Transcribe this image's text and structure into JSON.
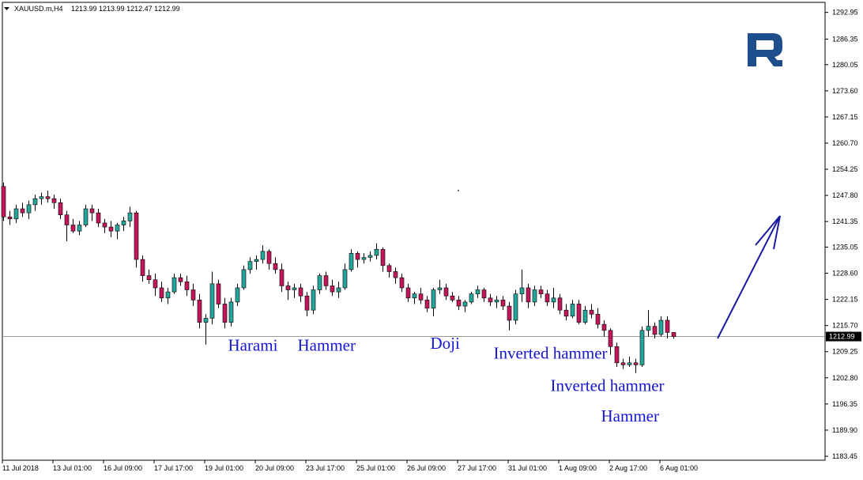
{
  "header": {
    "symbol": "XAUUSD.m,H4",
    "ohlc": "1213.99 1213.99 1212.47 1212.99"
  },
  "colors": {
    "bull": "#26a69a",
    "bear": "#c2185b",
    "annotation": "#1515d6",
    "arrow": "#1a1aa0",
    "logo": "#1f4e8c"
  },
  "chart_data": {
    "type": "candlestick",
    "ylim": [
      1183.45,
      1296.0
    ],
    "grid": false,
    "current_price": 1212.99,
    "current_price_label": "1212.99",
    "y_ticks": [
      "1292.95",
      "1286.35",
      "1280.05",
      "1273.60",
      "1267.15",
      "1260.70",
      "1254.25",
      "1247.80",
      "1241.35",
      "1235.05",
      "1228.60",
      "1222.15",
      "1215.70",
      "1209.25",
      "1202.80",
      "1196.35",
      "1189.90",
      "1183.45"
    ],
    "x_ticks": [
      "11 Jul 2018",
      "13 Jul 01:00",
      "16 Jul 09:00",
      "17 Jul 17:00",
      "19 Jul 01:00",
      "20 Jul 09:00",
      "23 Jul 17:00",
      "25 Jul 01:00",
      "26 Jul 09:00",
      "27 Jul 17:00",
      "31 Jul 01:00",
      "1 Aug 09:00",
      "2 Aug 17:00",
      "6 Aug 01:00"
    ],
    "candles": [
      [
        1250.0,
        1251.0,
        1241.5,
        1242.5
      ],
      [
        1242.5,
        1244.0,
        1240.5,
        1242.0
      ],
      [
        1242.0,
        1245.5,
        1241.0,
        1244.5
      ],
      [
        1244.5,
        1246.0,
        1242.5,
        1243.5
      ],
      [
        1243.5,
        1246.5,
        1242.0,
        1245.5
      ],
      [
        1245.5,
        1248.0,
        1244.0,
        1247.0
      ],
      [
        1247.0,
        1248.5,
        1245.5,
        1247.5
      ],
      [
        1247.5,
        1249.0,
        1246.0,
        1247.0
      ],
      [
        1247.0,
        1248.0,
        1244.5,
        1246.0
      ],
      [
        1246.0,
        1247.0,
        1242.0,
        1243.0
      ],
      [
        1243.0,
        1244.0,
        1236.5,
        1240.5
      ],
      [
        1240.5,
        1242.0,
        1238.5,
        1239.0
      ],
      [
        1239.0,
        1241.5,
        1238.0,
        1240.5
      ],
      [
        1240.5,
        1245.5,
        1240.0,
        1244.5
      ],
      [
        1244.5,
        1245.5,
        1241.5,
        1243.5
      ],
      [
        1243.5,
        1244.5,
        1240.0,
        1241.0
      ],
      [
        1241.0,
        1242.0,
        1238.5,
        1240.0
      ],
      [
        1240.0,
        1241.5,
        1237.5,
        1239.0
      ],
      [
        1239.0,
        1241.0,
        1237.0,
        1240.5
      ],
      [
        1240.5,
        1242.5,
        1239.0,
        1241.5
      ],
      [
        1241.5,
        1245.0,
        1240.0,
        1243.5
      ],
      [
        1243.5,
        1244.0,
        1230.0,
        1232.0
      ],
      [
        1232.0,
        1233.0,
        1226.5,
        1228.0
      ],
      [
        1228.0,
        1229.5,
        1226.0,
        1227.0
      ],
      [
        1227.0,
        1228.5,
        1223.0,
        1225.0
      ],
      [
        1225.0,
        1226.5,
        1221.5,
        1222.5
      ],
      [
        1222.5,
        1225.0,
        1221.0,
        1224.0
      ],
      [
        1224.0,
        1228.5,
        1223.5,
        1227.5
      ],
      [
        1227.5,
        1228.5,
        1225.5,
        1226.5
      ],
      [
        1226.5,
        1228.0,
        1223.0,
        1224.5
      ],
      [
        1224.5,
        1226.0,
        1220.5,
        1222.0
      ],
      [
        1222.0,
        1223.5,
        1215.0,
        1216.5
      ],
      [
        1216.5,
        1218.5,
        1211.0,
        1217.5
      ],
      [
        1217.5,
        1229.0,
        1216.0,
        1226.0
      ],
      [
        1226.0,
        1227.0,
        1220.0,
        1221.0
      ],
      [
        1221.0,
        1222.5,
        1215.0,
        1216.5
      ],
      [
        1216.5,
        1222.5,
        1215.5,
        1221.5
      ],
      [
        1221.5,
        1226.0,
        1220.5,
        1225.0
      ],
      [
        1225.0,
        1230.5,
        1224.5,
        1229.5
      ],
      [
        1229.5,
        1232.5,
        1228.5,
        1231.5
      ],
      [
        1231.5,
        1233.0,
        1229.5,
        1232.0
      ],
      [
        1232.0,
        1235.5,
        1231.0,
        1234.0
      ],
      [
        1234.0,
        1234.5,
        1229.5,
        1231.0
      ],
      [
        1231.0,
        1232.5,
        1228.5,
        1229.5
      ],
      [
        1229.5,
        1231.0,
        1224.0,
        1225.5
      ],
      [
        1225.5,
        1226.5,
        1222.0,
        1224.5
      ],
      [
        1224.5,
        1226.0,
        1222.5,
        1225.0
      ],
      [
        1225.0,
        1226.0,
        1221.5,
        1223.0
      ],
      [
        1223.0,
        1224.0,
        1218.0,
        1219.5
      ],
      [
        1219.5,
        1225.5,
        1218.5,
        1224.5
      ],
      [
        1224.5,
        1228.5,
        1223.5,
        1228.0
      ],
      [
        1228.0,
        1229.0,
        1224.5,
        1225.5
      ],
      [
        1225.5,
        1227.0,
        1223.0,
        1224.0
      ],
      [
        1224.0,
        1226.5,
        1222.5,
        1225.0
      ],
      [
        1225.0,
        1231.0,
        1224.5,
        1229.5
      ],
      [
        1229.5,
        1234.5,
        1229.0,
        1233.5
      ],
      [
        1233.5,
        1234.0,
        1230.0,
        1232.0
      ],
      [
        1232.0,
        1233.5,
        1231.0,
        1232.5
      ],
      [
        1232.5,
        1234.0,
        1231.5,
        1233.0
      ],
      [
        1233.0,
        1236.0,
        1232.0,
        1234.5
      ],
      [
        1234.5,
        1235.0,
        1229.0,
        1230.5
      ],
      [
        1230.5,
        1231.0,
        1227.5,
        1229.0
      ],
      [
        1229.0,
        1230.0,
        1226.0,
        1227.5
      ],
      [
        1227.5,
        1228.5,
        1224.0,
        1225.0
      ],
      [
        1225.0,
        1226.0,
        1221.5,
        1222.5
      ],
      [
        1222.5,
        1224.0,
        1221.0,
        1223.5
      ],
      [
        1223.5,
        1225.0,
        1221.0,
        1222.0
      ],
      [
        1222.0,
        1223.0,
        1219.0,
        1220.0
      ],
      [
        1220.0,
        1225.0,
        1218.0,
        1224.5
      ],
      [
        1224.5,
        1227.0,
        1223.5,
        1225.0
      ],
      [
        1225.0,
        1226.0,
        1222.0,
        1223.0
      ],
      [
        1223.0,
        1224.0,
        1221.5,
        1222.0
      ],
      [
        1222.0,
        1223.0,
        1219.5,
        1220.5
      ],
      [
        1220.5,
        1222.0,
        1219.0,
        1221.5
      ],
      [
        1221.5,
        1224.0,
        1221.0,
        1223.5
      ],
      [
        1223.5,
        1225.5,
        1222.5,
        1224.5
      ],
      [
        1224.5,
        1225.0,
        1221.5,
        1222.5
      ],
      [
        1222.5,
        1223.5,
        1220.5,
        1221.5
      ],
      [
        1221.5,
        1223.0,
        1220.0,
        1222.0
      ],
      [
        1222.0,
        1223.0,
        1219.5,
        1220.5
      ],
      [
        1220.5,
        1221.5,
        1214.5,
        1217.0
      ],
      [
        1217.0,
        1224.5,
        1216.0,
        1223.5
      ],
      [
        1223.5,
        1229.5,
        1221.5,
        1225.0
      ],
      [
        1225.0,
        1226.0,
        1220.0,
        1221.5
      ],
      [
        1221.5,
        1225.5,
        1220.5,
        1224.5
      ],
      [
        1224.5,
        1225.5,
        1222.5,
        1223.5
      ],
      [
        1223.5,
        1224.5,
        1220.5,
        1221.5
      ],
      [
        1221.5,
        1225.0,
        1220.0,
        1222.5
      ],
      [
        1222.5,
        1223.5,
        1218.5,
        1219.5
      ],
      [
        1219.5,
        1221.0,
        1217.0,
        1218.0
      ],
      [
        1218.0,
        1222.0,
        1217.5,
        1221.0
      ],
      [
        1221.0,
        1222.0,
        1216.0,
        1216.5
      ],
      [
        1216.5,
        1220.5,
        1216.0,
        1219.5
      ],
      [
        1219.5,
        1221.0,
        1217.5,
        1218.5
      ],
      [
        1218.5,
        1220.0,
        1215.0,
        1216.0
      ],
      [
        1216.0,
        1217.0,
        1213.0,
        1214.5
      ],
      [
        1214.5,
        1215.0,
        1208.5,
        1210.5
      ],
      [
        1210.5,
        1211.5,
        1205.5,
        1206.5
      ],
      [
        1206.5,
        1207.5,
        1205.0,
        1206.0
      ],
      [
        1206.0,
        1208.0,
        1205.5,
        1206.5
      ],
      [
        1206.5,
        1207.5,
        1204.0,
        1206.0
      ],
      [
        1206.0,
        1215.5,
        1205.5,
        1214.5
      ],
      [
        1214.5,
        1219.5,
        1213.0,
        1215.5
      ],
      [
        1215.5,
        1216.5,
        1212.5,
        1213.5
      ],
      [
        1213.5,
        1218.0,
        1213.0,
        1217.0
      ],
      [
        1217.0,
        1218.0,
        1212.5,
        1214.0
      ],
      [
        1213.99,
        1213.99,
        1212.47,
        1212.99
      ]
    ],
    "annotations": [
      {
        "text": "Harami",
        "x": 36,
        "y": 1209.5
      },
      {
        "text": "Hammer",
        "x": 47,
        "y": 1209.5
      },
      {
        "text": "Doji",
        "x": 68,
        "y": 1210.0
      },
      {
        "text": "Inverted hammer",
        "x": 78,
        "y": 1207.5
      },
      {
        "text": "Inverted hammer",
        "x": 87,
        "y": 1199.5
      },
      {
        "text": "Hammer",
        "x": 95,
        "y": 1192.0
      }
    ]
  }
}
